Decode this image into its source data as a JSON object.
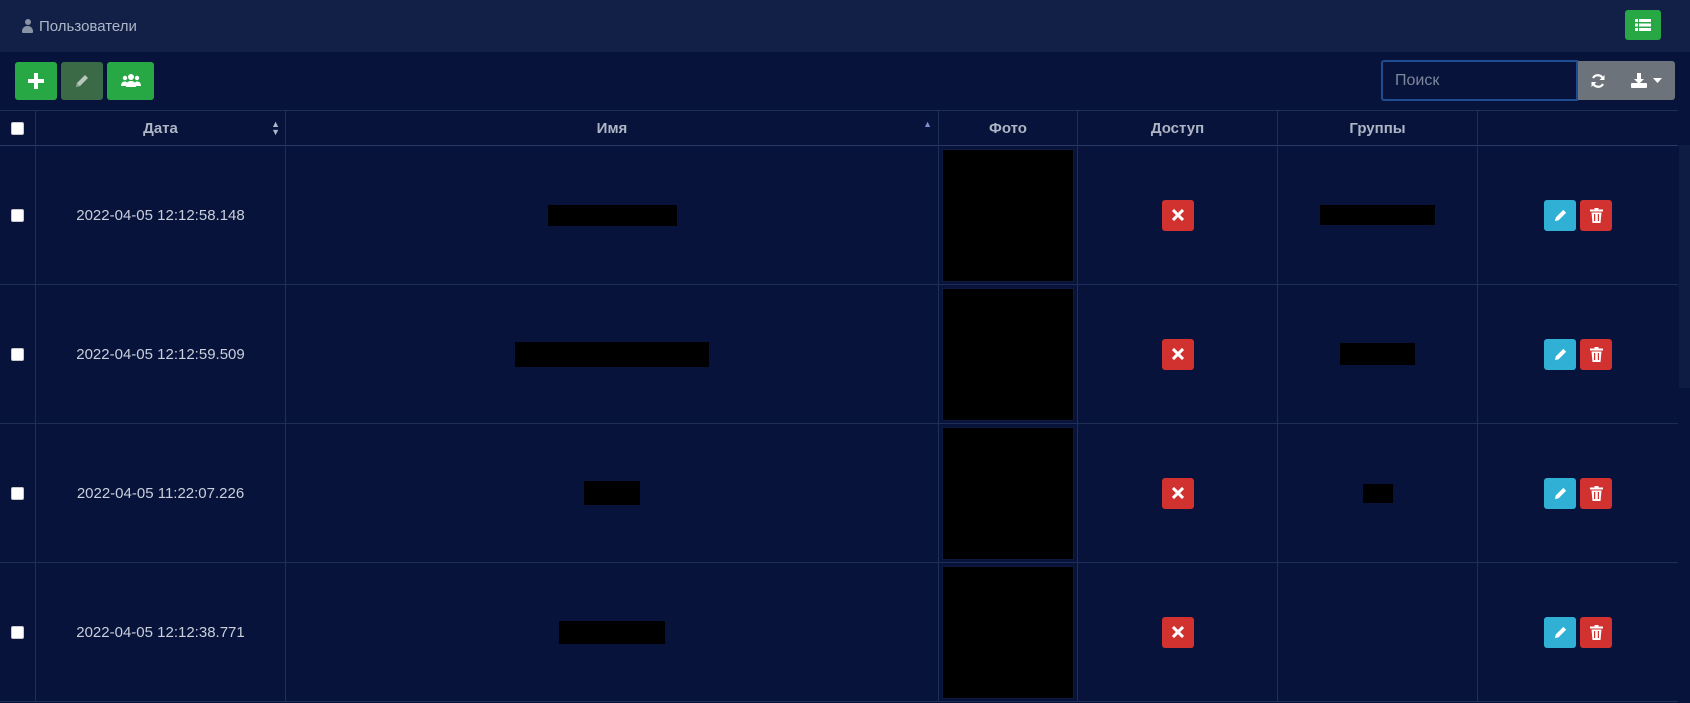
{
  "header": {
    "title": "Пользователи",
    "icon": "user-icon",
    "menu_icon": "list-icon"
  },
  "toolbar": {
    "buttons": [
      {
        "name": "add-button",
        "icon": "plus-icon",
        "color": "#28a745"
      },
      {
        "name": "edit-button",
        "icon": "pencil-icon",
        "color": "#3a6b46"
      },
      {
        "name": "groups-button",
        "icon": "users-icon",
        "color": "#28a745"
      }
    ],
    "search": {
      "placeholder": "Поиск",
      "value": ""
    },
    "refresh_icon": "refresh-icon",
    "export_icon": "download-icon"
  },
  "table": {
    "columns": [
      "Дата",
      "Имя",
      "Фото",
      "Доступ",
      "Группы",
      ""
    ],
    "sort": {
      "date": "both",
      "name": "asc"
    },
    "rows": [
      {
        "date": "2022-04-05 12:12:58.148",
        "access": false
      },
      {
        "date": "2022-04-05 12:12:59.509",
        "access": false
      },
      {
        "date": "2022-04-05 11:22:07.226",
        "access": false
      },
      {
        "date": "2022-04-05 12:12:38.771",
        "access": false
      }
    ]
  },
  "colors": {
    "background": "#07133a",
    "header": "#121f47",
    "green": "#28a745",
    "red": "#d1312f",
    "cyan": "#31b0d5",
    "gray": "#6c737a"
  }
}
